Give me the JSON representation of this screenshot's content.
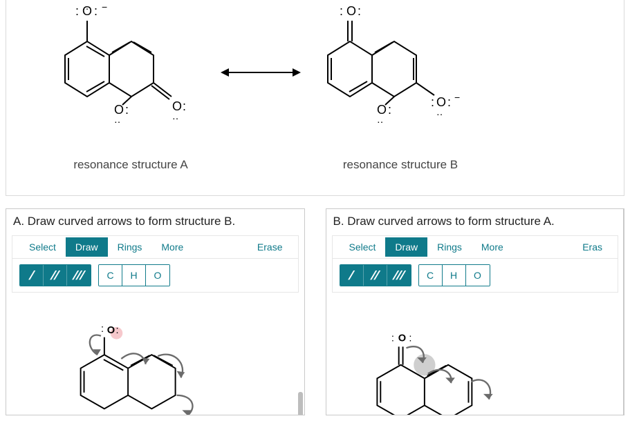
{
  "top": {
    "captionA": "resonance structure A",
    "captionB": "resonance structure B",
    "atom_label_O": "O"
  },
  "panelA": {
    "title": "A. Draw curved arrows to form structure B.",
    "tabs": {
      "select": "Select",
      "draw": "Draw",
      "rings": "Rings",
      "more": "More"
    },
    "erase": "Erase",
    "elements": {
      "c": "C",
      "h": "H",
      "o": "O"
    },
    "canvas_atom_O": "O"
  },
  "panelB": {
    "title": "B. Draw curved arrows to form structure A.",
    "tabs": {
      "select": "Select",
      "draw": "Draw",
      "rings": "Rings",
      "more": "More"
    },
    "erase": "Eras",
    "elements": {
      "c": "C",
      "h": "H",
      "o": "O"
    },
    "canvas_atom_O": "O"
  }
}
